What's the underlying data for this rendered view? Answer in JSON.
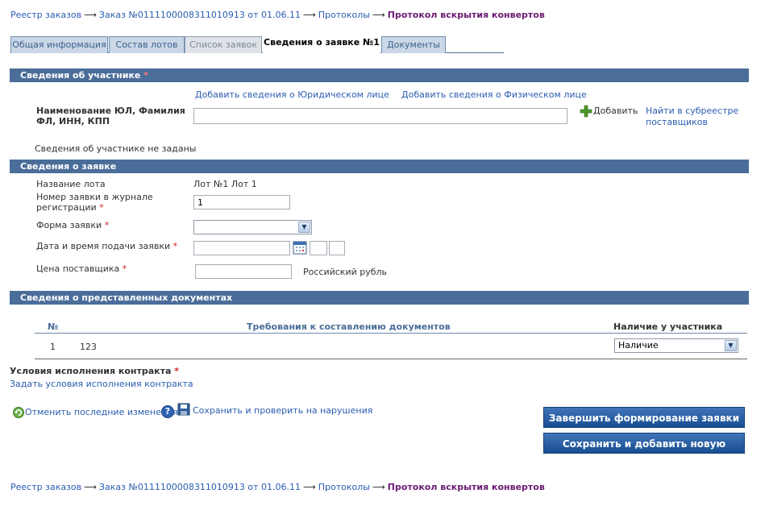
{
  "breadcrumb": {
    "items": [
      "Реестр заказов",
      "Заказ №0111100008311010913 от 01.06.11",
      "Протоколы"
    ],
    "current": "Протокол вскрытия конвертов",
    "separator": "⟶"
  },
  "tabs": [
    {
      "label": "Общая информация"
    },
    {
      "label": "Состав лотов"
    },
    {
      "label": "Список заявок"
    },
    {
      "label": "Сведения о заявке №1"
    },
    {
      "label": "Документы"
    }
  ],
  "participant": {
    "section_title": "Сведения об участнике",
    "required_mark": "*",
    "add_legal_link": "Добавить сведения о Юридическом лице",
    "add_person_link": "Добавить сведения о Физическом лице",
    "name_label": "Наименование ЮЛ, Фамилия ФЛ, ИНН, КПП",
    "name_value": "",
    "add_button": "Добавить",
    "find_link": "Найти в субреестре поставщиков",
    "empty_text": "Сведения об участнике не заданы"
  },
  "application": {
    "section_title": "Сведения о заявке",
    "lot_label": "Название лота",
    "lot_value": "Лот №1 Лот 1",
    "number_label": "Номер заявки в журнале регистрации",
    "number_value": "1",
    "form_label": "Форма заявки",
    "form_value": "",
    "datetime_label": "Дата и время подачи заявки",
    "date_value": "",
    "hour_value": "",
    "minute_value": "",
    "price_label": "Цена поставщика",
    "price_value": "",
    "currency": "Российский рубль"
  },
  "documents": {
    "section_title": "Сведения о представленных документах",
    "columns": [
      "№",
      "Требования к составлению документов",
      "Наличие у участника"
    ],
    "rows": [
      {
        "num": "1",
        "requirement": "123",
        "presence": "Наличие"
      }
    ]
  },
  "contract": {
    "label": "Условия исполнения контракта",
    "link": "Задать условия исполнения контракта"
  },
  "actions": {
    "undo_link": "Отменить последние изменения",
    "save_check_link": "Сохранить и проверить на нарушения",
    "finish_button": "Завершить формирование заявки",
    "save_new_button": "Сохранить и добавить новую"
  },
  "colors": {
    "section_bar": "#4b6d99",
    "link": "#2a5db0",
    "current_crumb": "#6a1a72",
    "button": "#184f92"
  }
}
